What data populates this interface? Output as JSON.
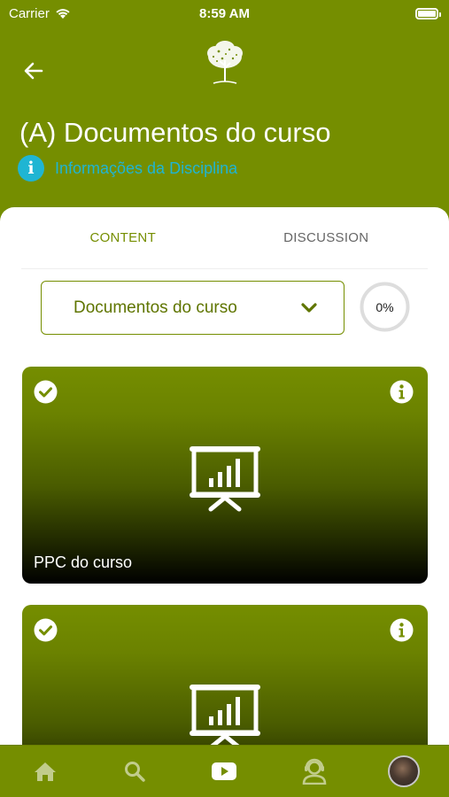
{
  "status_bar": {
    "carrier": "Carrier",
    "time": "8:59 AM"
  },
  "header": {
    "title": "(A) Documentos do curso",
    "info_link": "Informações da Disciplina",
    "info_icon_glyph": "i"
  },
  "tabs": [
    {
      "label": "CONTENT",
      "active": true
    },
    {
      "label": "DISCUSSION",
      "active": false
    }
  ],
  "module_select": {
    "selected": "Documentos do curso"
  },
  "progress": {
    "label": "0%",
    "value": 0
  },
  "cards": [
    {
      "title": "PPC do curso",
      "completed": true,
      "icon": "presentation-icon"
    },
    {
      "title": "",
      "completed": true,
      "icon": "presentation-icon"
    }
  ],
  "bottom_nav": [
    {
      "name": "home-icon"
    },
    {
      "name": "search-icon"
    },
    {
      "name": "youtube-icon"
    },
    {
      "name": "support-icon"
    },
    {
      "name": "avatar"
    }
  ],
  "colors": {
    "brand_green": "#758e00",
    "info_cyan": "#1fb5d3",
    "white": "#ffffff"
  }
}
